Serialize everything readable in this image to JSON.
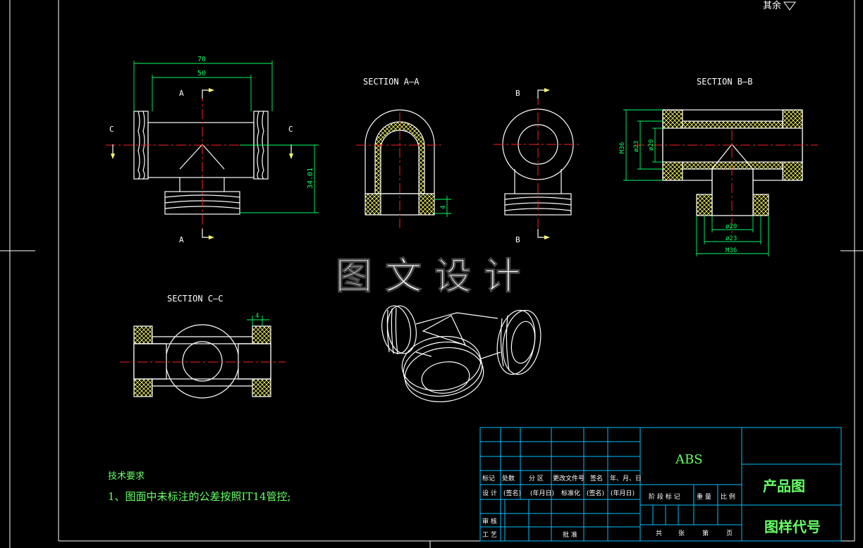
{
  "corner_text": "其余",
  "views": {
    "front": {
      "dim_overall": "70",
      "dim_inner": "50",
      "dim_height": "34.01",
      "cut_a_top": "A",
      "cut_a_bottom": "A",
      "cut_c_left": "C",
      "cut_c_right": "C"
    },
    "section_aa": {
      "title": "SECTION A–A",
      "dim": "4"
    },
    "side": {
      "cut_b_top": "B",
      "cut_b_bottom": "B"
    },
    "section_bb": {
      "title": "SECTION B–B",
      "dim_m36_v": "M36",
      "dim_d23_v": "ø23",
      "dim_d20_v": "ø20",
      "dim_d20_h": "ø20",
      "dim_d23_h": "ø23",
      "dim_m36_h": "M36"
    },
    "section_cc": {
      "title": "SECTION C–C",
      "dim": "4"
    }
  },
  "watermark": "图 文 设 计",
  "tech_requirements": {
    "heading": "技术要求",
    "item1": "1、图面中未标注的公差按照IT14管控;"
  },
  "title_block": {
    "material": "ABS",
    "drawing_type": "产品图",
    "drawing_code": "图样代号",
    "row_headers": [
      "标记",
      "处数",
      "分 区",
      "更改文件号",
      "签名",
      "年、月、日"
    ],
    "row_design": [
      "设 计",
      "(签名)",
      "(年月日)",
      "标准化",
      "(签名)",
      "(年月日)"
    ],
    "row_stage": [
      "阶 段 标 记",
      "重 量",
      "比 例"
    ],
    "reviewer": "审 核",
    "process": "工 艺",
    "approve": "批 准",
    "sheets": [
      "共",
      "张",
      "第",
      "页"
    ]
  },
  "colors": {
    "outline": "#ffffff",
    "drawing": "#ffff66",
    "center": "#ff2020",
    "dimension": "#00ff66",
    "grid": "#00c0ff",
    "text_green": "#33ff33"
  }
}
